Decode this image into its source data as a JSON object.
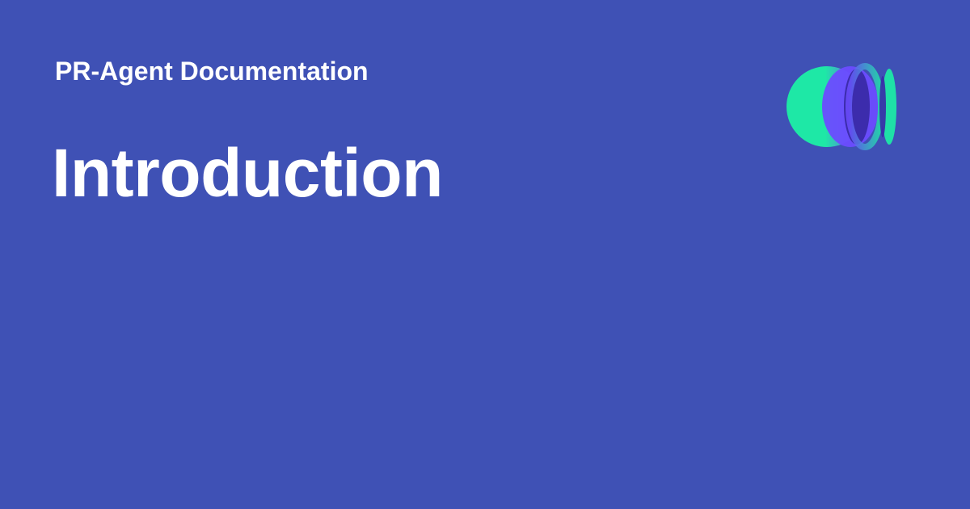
{
  "header": {
    "site_name": "PR-Agent Documentation",
    "page_title": "Introduction",
    "logo_icon": "overlapping-circles-logo-icon"
  },
  "colors": {
    "background": "#3f51b5",
    "text": "#ffffff",
    "logo_teal": "#1ee8a6",
    "logo_purple": "#6b4cff",
    "logo_overlap": "#3a2aa8"
  }
}
